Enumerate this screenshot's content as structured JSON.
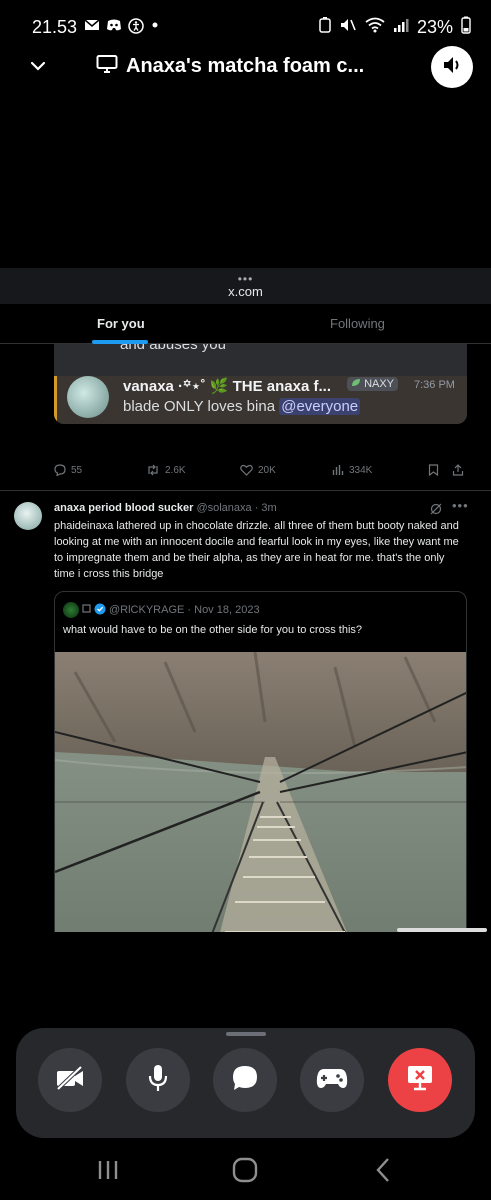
{
  "status_bar": {
    "time": "21.53",
    "battery": "23%",
    "left_icons": [
      "mail-icon",
      "discord-icon",
      "accessibility-icon",
      "dot-icon"
    ],
    "right_icons": [
      "battery-saver-icon",
      "mute-icon",
      "wifi-icon",
      "signal-icon",
      "battery-icon"
    ]
  },
  "call_header": {
    "title": "Anaxa's matcha foam c..."
  },
  "browser": {
    "url": "x.com",
    "menu_dots": "•••"
  },
  "feed": {
    "tabs": [
      {
        "label": "For you",
        "active": true
      },
      {
        "label": "Following",
        "active": false
      }
    ],
    "tweet1": {
      "embedded": {
        "cut_text": "and abuses you",
        "username": "vanaxa ·꙳⋆˚ 🌿 THE anaxa f...",
        "badge": "NAXY",
        "time": "7:36 PM",
        "message": "blade ONLY loves bina",
        "mention": "@everyone"
      },
      "stats": {
        "replies": "55",
        "reposts": "2.6K",
        "likes": "20K",
        "views": "334K"
      }
    },
    "tweet2": {
      "name": "anaxa period blood sucker",
      "handle": "@solanaxa · 3m",
      "body": "phaideinaxa lathered up in chocolate drizzle. all three of them butt booty naked and looking at me with an innocent docile and fearful look in my eyes, like they want me to impregnate them and be their alpha, as they are in heat for me. that's the only time i cross this bridge",
      "menu": "•••",
      "quote": {
        "handle": "@RlCKYRAGE · Nov 18, 2023",
        "text": "what would have to be on the other side for you to cross this?"
      }
    }
  },
  "controls": [
    {
      "name": "camera-off-button",
      "icon": "camera-off-icon"
    },
    {
      "name": "microphone-button",
      "icon": "microphone-icon"
    },
    {
      "name": "chat-button",
      "icon": "chat-icon"
    },
    {
      "name": "activities-button",
      "icon": "gamepad-icon"
    },
    {
      "name": "stop-stream-button",
      "icon": "screen-stop-icon",
      "color": "#ed4245"
    }
  ],
  "nav": [
    "recents-icon",
    "home-icon",
    "back-icon"
  ],
  "colors": {
    "accent_blue": "#1d9bf0",
    "danger_red": "#ed4245",
    "discord_mention": "#3c4270"
  }
}
